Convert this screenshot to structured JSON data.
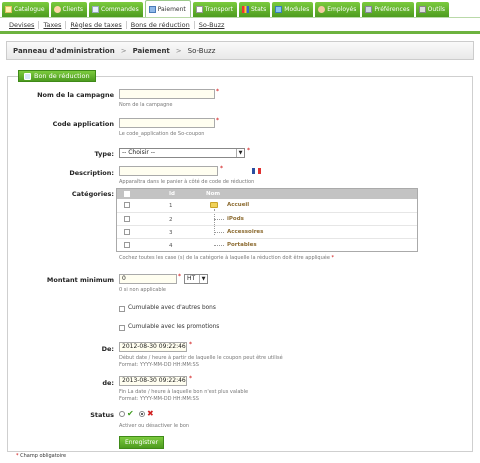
{
  "main_tabs": [
    {
      "label": "Catalogue",
      "color": "#4d9b1f",
      "active": false
    },
    {
      "label": "Clients",
      "color": "#4d9b1f",
      "active": false
    },
    {
      "label": "Commandes",
      "color": "#4d9b1f",
      "active": false
    },
    {
      "label": "Paiement",
      "color": "#ffffff",
      "active": true
    },
    {
      "label": "Transport",
      "color": "#4d9b1f",
      "active": false
    },
    {
      "label": "Stats",
      "color": "#4d9b1f",
      "active": false
    },
    {
      "label": "Modules",
      "color": "#4d9b1f",
      "active": false
    },
    {
      "label": "Employés",
      "color": "#4d9b1f",
      "active": false
    },
    {
      "label": "Préférences",
      "color": "#4d9b1f",
      "active": false
    },
    {
      "label": "Outils",
      "color": "#4d9b1f",
      "active": false
    }
  ],
  "sub_tabs": [
    "Devises",
    "Taxes",
    "Règles de taxes",
    "Bons de réduction",
    "So-Buzz"
  ],
  "breadcrumb": {
    "item1": "Panneau d'administration",
    "item2": "Paiement",
    "current": "So-Buzz",
    "separator": ">"
  },
  "fieldset": {
    "legend": "Bon de réduction"
  },
  "form": {
    "campaign_name": {
      "label": "Nom de la campagne",
      "value": "",
      "hint": "Nom de la campagne"
    },
    "app_code": {
      "label": "Code application",
      "value": "",
      "hint": "Le code_application de So-coupon"
    },
    "type": {
      "label": "Type:",
      "selected": "-- Choisir --"
    },
    "description": {
      "label": "Description:",
      "value": "",
      "hint": "Apparaîtra dans le panier à côté de code de réduction"
    },
    "categories": {
      "label": "Catégories:",
      "col_id": "Id",
      "col_name": "Nom",
      "rows": [
        {
          "id": "1",
          "name": "Accueil"
        },
        {
          "id": "2",
          "name": "iPods"
        },
        {
          "id": "3",
          "name": "Accessoires"
        },
        {
          "id": "4",
          "name": "Portables"
        }
      ],
      "hint": "Cochez toutes les case (s) de la catégorie à laquelle la réduction doit être appliquée"
    },
    "min_amount": {
      "label": "Montant minimum",
      "value": "0",
      "tax_option": "HT",
      "hint": "0 si non applicable"
    },
    "cumulable_bons": {
      "label": "Cumulable avec d'autres bons"
    },
    "cumulable_promos": {
      "label": "Cumulable avec les promotions"
    },
    "date_from": {
      "label": "De:",
      "value": "2012-08-30 09:22:46",
      "hint1": "Début date / heure à partir de laquelle le coupon peut être utilisé",
      "hint2": "Format: YYYY-MM-DD HH:MM:SS"
    },
    "date_to": {
      "label": "de:",
      "value": "2013-08-30 09:22:46",
      "hint1": "Fin La date / heure à laquelle bon n'est plus valable",
      "hint2": "Format: YYYY-MM-DD HH:MM:SS"
    },
    "status": {
      "label": "Status",
      "hint": "Activer ou désactiver le bon",
      "enabled_icon": "check-icon",
      "disabled_icon": "cross-icon",
      "selected": "enabled"
    },
    "submit": "Enregistrer",
    "required_mark": "*",
    "footnote": "Champ obligatoire"
  }
}
